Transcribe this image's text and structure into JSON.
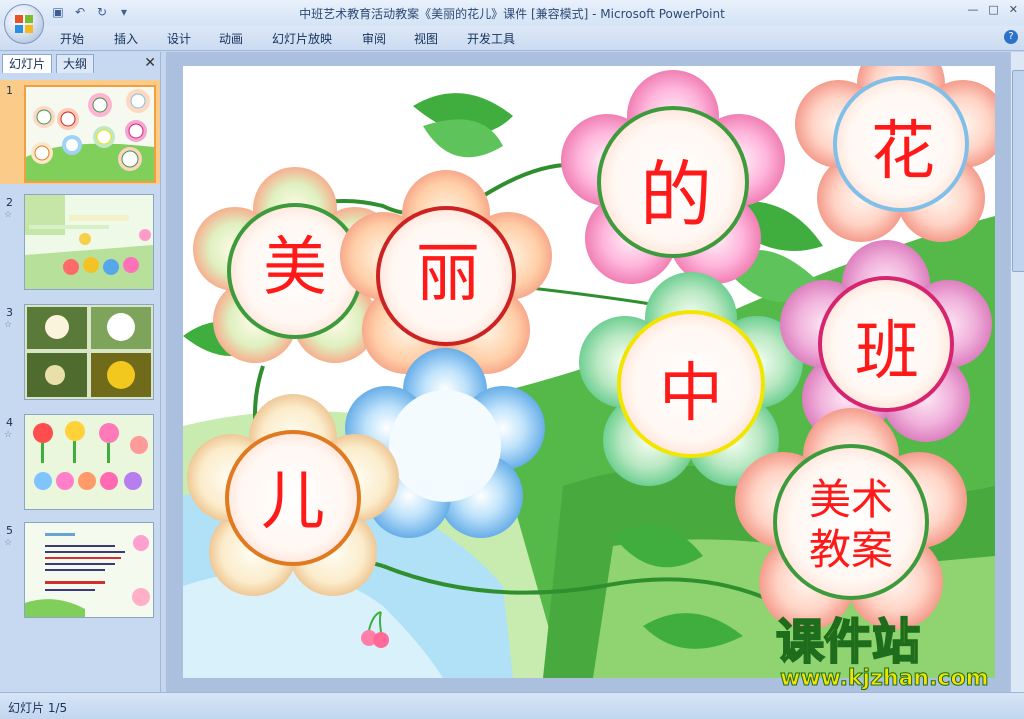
{
  "window": {
    "title": "中班艺术教育活动教案《美丽的花儿》课件 [兼容模式] - Microsoft PowerPoint"
  },
  "ribbon": {
    "tabs": [
      "开始",
      "插入",
      "设计",
      "动画",
      "幻灯片放映",
      "审阅",
      "视图",
      "开发工具"
    ]
  },
  "left_pane": {
    "tabs": [
      "幻灯片",
      "大纲"
    ],
    "thumbnails": [
      {
        "number": "1",
        "selected": true
      },
      {
        "number": "2",
        "selected": false
      },
      {
        "number": "3",
        "selected": false
      },
      {
        "number": "4",
        "selected": false
      },
      {
        "number": "5",
        "selected": false
      }
    ]
  },
  "slide": {
    "chars": {
      "mei": "美",
      "li": "丽",
      "de": "的",
      "hua": "花",
      "zhong": "中",
      "ban": "班",
      "er": "儿",
      "meishu": "美术",
      "jiaoan": "教案"
    },
    "watermark": {
      "brand": "课件站",
      "url": "www.kjzhan.com"
    }
  },
  "statusbar": {
    "text": "幻灯片 1/5"
  },
  "colors": {
    "label_red": "#ff1a1a",
    "leaf_green": "#3fae3f",
    "ring_green": "#3d9b3d",
    "ring_red": "#cc2222",
    "ring_yellow": "#f2e500",
    "ring_magenta": "#d6256f",
    "ring_orange": "#e07a20",
    "ring_blue": "#7fbfe8"
  }
}
